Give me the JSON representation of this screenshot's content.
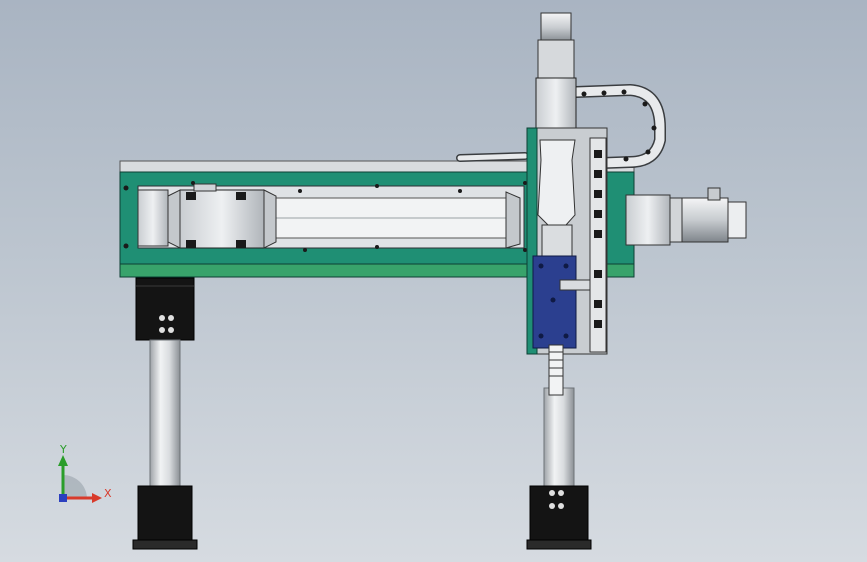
{
  "viewport": {
    "background_top": "#a9b4c2",
    "background_bottom": "#d6dbe1"
  },
  "model": {
    "frame_color": "#1f8f74",
    "carriage_color": "#2b3f8f",
    "metal_light": "#e3e6e9",
    "metal_mid": "#b7bcc1",
    "metal_dark": "#4a4f55",
    "base_color": "#111111"
  },
  "triad": {
    "x_label": "X",
    "y_label": "Y",
    "x_color": "#d83a2b",
    "y_color": "#2a9d2a",
    "z_color": "#2b3fbf"
  }
}
